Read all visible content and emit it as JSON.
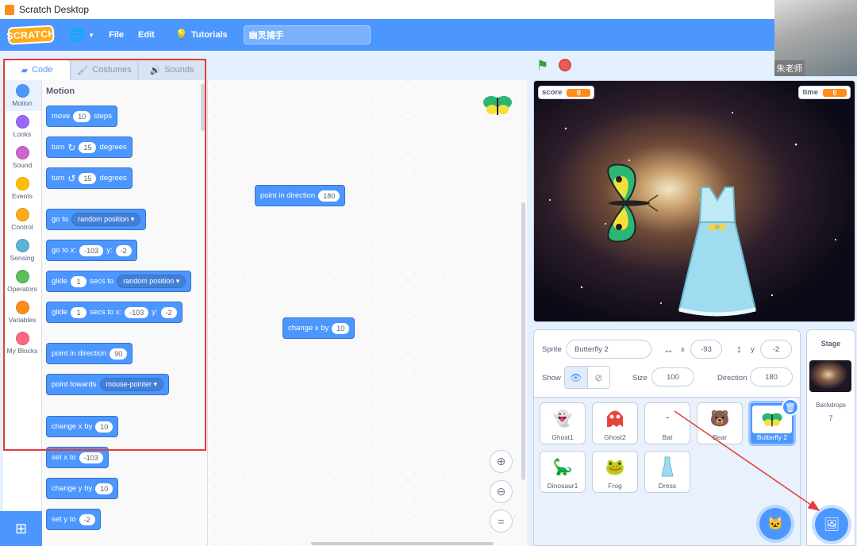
{
  "window": {
    "title": "Scratch Desktop"
  },
  "menubar": {
    "logo": "SCRATCH",
    "file": "File",
    "edit": "Edit",
    "tutorials": "Tutorials",
    "project_name": "幽灵捕手"
  },
  "webcam": {
    "label": "朱老师"
  },
  "tabs": {
    "code": "Code",
    "costumes": "Costumes",
    "sounds": "Sounds"
  },
  "categories": [
    {
      "label": "Motion",
      "color": "#4c97ff"
    },
    {
      "label": "Looks",
      "color": "#9966ff"
    },
    {
      "label": "Sound",
      "color": "#cf63cf"
    },
    {
      "label": "Events",
      "color": "#ffbf00"
    },
    {
      "label": "Control",
      "color": "#ffab19"
    },
    {
      "label": "Sensing",
      "color": "#5cb1d6"
    },
    {
      "label": "Operators",
      "color": "#59c059"
    },
    {
      "label": "Variables",
      "color": "#ff8c1a"
    },
    {
      "label": "My Blocks",
      "color": "#ff6680"
    }
  ],
  "palette": {
    "title": "Motion",
    "move": {
      "a": "move",
      "v": "10",
      "b": "steps"
    },
    "turn_right": {
      "a": "turn",
      "v": "15",
      "b": "degrees"
    },
    "turn_left": {
      "a": "turn",
      "v": "15",
      "b": "degrees"
    },
    "goto": {
      "a": "go to",
      "dd": "random position"
    },
    "goto_xy": {
      "a": "go to x:",
      "x": "-103",
      "b": "y:",
      "y": "-2"
    },
    "glide_to": {
      "a": "glide",
      "v": "1",
      "b": "secs to",
      "dd": "random position"
    },
    "glide_xy": {
      "a": "glide",
      "v": "1",
      "b": "secs to x:",
      "x": "-103",
      "c": "y:",
      "y": "-2"
    },
    "point_dir": {
      "a": "point in direction",
      "v": "90"
    },
    "point_towards": {
      "a": "point towards",
      "dd": "mouse-pointer"
    },
    "change_x": {
      "a": "change x by",
      "v": "10"
    },
    "set_x": {
      "a": "set x to",
      "v": "-103"
    },
    "change_y": {
      "a": "change y by",
      "v": "10"
    },
    "set_y": {
      "a": "set y to",
      "v": "-2"
    }
  },
  "script": {
    "point_dir": {
      "a": "point in direction",
      "v": "180"
    },
    "change_x": {
      "a": "change x by",
      "v": "10"
    }
  },
  "stage": {
    "score": {
      "label": "score",
      "value": "0"
    },
    "time": {
      "label": "time",
      "value": "0"
    }
  },
  "sprite_info": {
    "sprite_label": "Sprite",
    "sprite_name": "Butterfly 2",
    "x_label": "x",
    "x": "-93",
    "y_label": "y",
    "y": "-2",
    "show_label": "Show",
    "size_label": "Size",
    "size": "100",
    "direction_label": "Direction",
    "direction": "180"
  },
  "sprites": [
    "Ghost1",
    "Ghost2",
    "Bat",
    "Bear",
    "Butterfly 2",
    "Dinosaur1",
    "Frog",
    "Dress"
  ],
  "stage_pane": {
    "title": "Stage",
    "backdrops_label": "Backdrops",
    "backdrops_count": "7"
  }
}
